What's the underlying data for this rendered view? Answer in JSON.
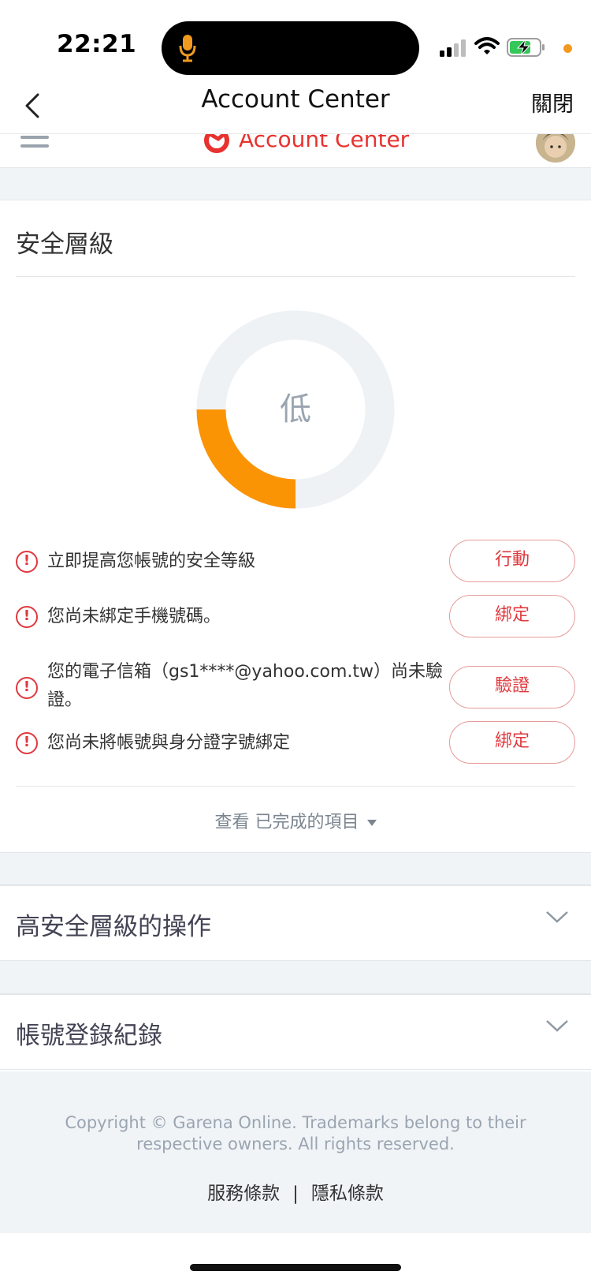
{
  "status_bar": {
    "time": "22:21"
  },
  "nav": {
    "title": "Account Center",
    "close_label": "關閉"
  },
  "site_header": {
    "brand": "Account Center"
  },
  "security": {
    "title": "安全層級",
    "level": "低",
    "level_fraction": 0.25,
    "colors": {
      "progress": "#FA9405",
      "track": "#EEF2F5",
      "alert": "#E0393E"
    },
    "tasks": [
      {
        "text": "立即提高您帳號的安全等級",
        "button": "行動"
      },
      {
        "text": "您尚未綁定手機號碼。",
        "button": "綁定"
      },
      {
        "text": "您的電子信箱（gs1****@yahoo.com.tw）尚未驗證。",
        "button": "驗證"
      },
      {
        "text": "您尚未將帳號與身分證字號綁定",
        "button": "綁定"
      }
    ],
    "view_done": "查看 已完成的項目"
  },
  "sections": {
    "high_security_ops": "高安全層級的操作",
    "login_history": "帳號登錄紀錄"
  },
  "footer": {
    "copyright": "Copyright © Garena Online. Trademarks belong to their respective owners. All rights reserved.",
    "terms": "服務條款",
    "separator": "|",
    "privacy": "隱私條款"
  }
}
